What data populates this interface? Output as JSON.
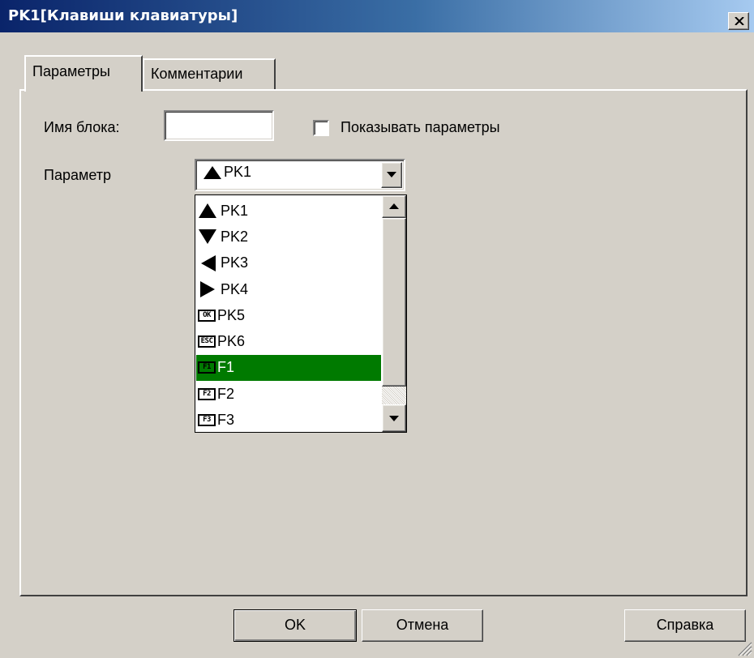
{
  "window": {
    "title": "PK1[Клавиши клавиатуры]"
  },
  "tabs": [
    {
      "label": "Параметры",
      "active": true
    },
    {
      "label": "Комментарии",
      "active": false
    }
  ],
  "form": {
    "block_name_label": "Имя блока:",
    "block_name_value": "",
    "show_params_label": "Показывать параметры",
    "show_params_checked": false,
    "param_label": "Параметр",
    "param_selected": "PK1",
    "param_selected_icon": "up-triangle-icon"
  },
  "dropdown": {
    "items": [
      {
        "label": "PK1",
        "icon": "up-triangle-icon"
      },
      {
        "label": "PK2",
        "icon": "down-triangle-icon"
      },
      {
        "label": "PK3",
        "icon": "left-triangle-icon"
      },
      {
        "label": "PK4",
        "icon": "right-triangle-icon"
      },
      {
        "label": "PK5",
        "icon": "ok-key-icon",
        "icon_text": "OK"
      },
      {
        "label": "PK6",
        "icon": "esc-key-icon",
        "icon_text": "ESC"
      },
      {
        "label": "F1",
        "icon": "f1-key-icon",
        "icon_text": "F1",
        "selected": true
      },
      {
        "label": "F2",
        "icon": "f2-key-icon",
        "icon_text": "F2"
      },
      {
        "label": "F3",
        "icon": "f3-key-icon",
        "icon_text": "F3"
      }
    ],
    "selected_color": "#007a00"
  },
  "buttons": {
    "ok": "OK",
    "cancel": "Отмена",
    "help": "Справка"
  }
}
